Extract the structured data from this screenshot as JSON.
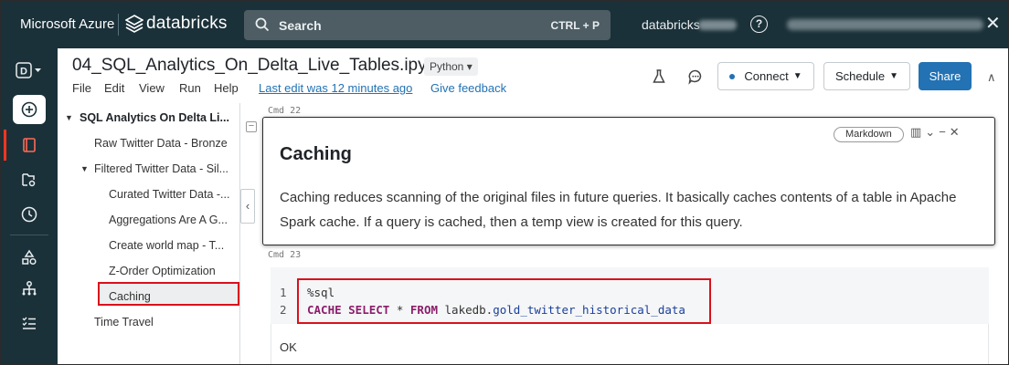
{
  "topbar": {
    "brand_azure": "Microsoft Azure",
    "brand_databricks": "databricks",
    "search_label": "Search",
    "search_shortcut": "CTRL + P",
    "workspace": "databricks",
    "help_label": "?",
    "close_label": "✕"
  },
  "notebook": {
    "title": "04_SQL_Analytics_On_Delta_Live_Tables.ipynb",
    "language": "Python ▾",
    "menu": [
      "File",
      "Edit",
      "View",
      "Run",
      "Help"
    ],
    "last_edit": "Last edit was 12 minutes ago",
    "feedback": "Give feedback",
    "connect_label": "Connect",
    "schedule_label": "Schedule",
    "share_label": "Share"
  },
  "toc": {
    "items": [
      {
        "label": "SQL Analytics On Delta Li...",
        "level": 0
      },
      {
        "label": "Raw Twitter Data - Bronze",
        "level": 1
      },
      {
        "label": "Filtered Twitter Data - Sil...",
        "level": 1
      },
      {
        "label": "Curated Twitter Data -...",
        "level": 2
      },
      {
        "label": "Aggregations Are A G...",
        "level": 2
      },
      {
        "label": "Create world map - T...",
        "level": 2
      },
      {
        "label": "Z-Order Optimization",
        "level": 2
      },
      {
        "label": "Caching",
        "level": 2,
        "selected": true
      },
      {
        "label": "Time Travel",
        "level": 1
      }
    ]
  },
  "cells": {
    "cmd22": "Cmd 22",
    "cmd23": "Cmd 23",
    "markdown_pill": "Markdown",
    "md_heading": "Caching",
    "md_text": "Caching reduces scanning of the original files in future queries. It basically caches contents of a table in Apache Spark cache. If a query is cached, then a temp view is created for this query.",
    "code_line_numbers": [
      "1",
      "2"
    ],
    "code_line1": "%sql",
    "code_kw1": "CACHE SELECT",
    "code_star": " * ",
    "code_kw2": "FROM",
    "code_schema": " lakedb.",
    "code_table": "gold_twitter_historical_data",
    "output": "OK"
  },
  "colors": {
    "topbar_bg": "#1b3139",
    "accent_blue": "#2272b4",
    "highlight_red": "#d9111c",
    "active_rail": "#ff3621"
  }
}
